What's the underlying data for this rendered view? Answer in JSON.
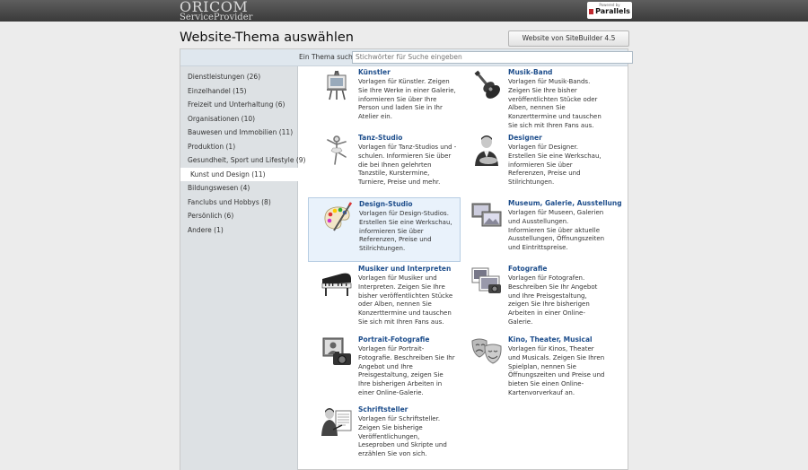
{
  "header": {
    "logo_line1": "ORICOM",
    "logo_line2": "ServiceProvider",
    "powered_by": "Powered by",
    "powered_brand": "Parallels"
  },
  "page": {
    "title": "Website-Thema auswählen",
    "import_button": "Website von SiteBuilder 4.5 importieren"
  },
  "search": {
    "label": "Ein Thema suchen",
    "placeholder": "Stichwörter für Suche eingeben"
  },
  "categories": [
    {
      "label": "Dienstleistungen (26)"
    },
    {
      "label": "Einzelhandel (15)"
    },
    {
      "label": "Freizeit und Unterhaltung (6)"
    },
    {
      "label": "Organisationen (10)"
    },
    {
      "label": "Bauwesen und Immobilien (11)"
    },
    {
      "label": "Produktion (1)"
    },
    {
      "label": "Gesundheit, Sport und Lifestyle (9)"
    },
    {
      "label": "Kunst und Design (11)",
      "active": true
    },
    {
      "label": "Bildungswesen (4)"
    },
    {
      "label": "Fanclubs und Hobbys (8)"
    },
    {
      "label": "Persönlich (6)"
    },
    {
      "label": "Andere (1)"
    }
  ],
  "themes": [
    {
      "title": "Künstler",
      "icon": "easel-icon",
      "desc": "Vorlagen für Künstler. Zeigen Sie Ihre Werke in einer Galerie, informieren Sie über Ihre Person und laden Sie in Ihr Atelier ein."
    },
    {
      "title": "Musik-Band",
      "icon": "guitar-icon",
      "desc": "Vorlagen für Musik-Bands. Zeigen Sie Ihre bisher veröffentlichten Stücke oder Alben, nennen Sie Konzerttermine und tauschen Sie sich mit Ihren Fans aus."
    },
    {
      "title": "Tanz-Studio",
      "icon": "dancer-icon",
      "desc": "Vorlagen für Tanz-Studios und -schulen. Informieren Sie über die bei Ihnen gelehrten Tanzstile, Kurstermine, Turniere, Preise und mehr."
    },
    {
      "title": "Designer",
      "icon": "designer-icon",
      "desc": "Vorlagen für Designer. Erstellen Sie eine Werkschau, informieren Sie über Referenzen, Preise und Stilrichtungen."
    },
    {
      "title": "Design-Studio",
      "icon": "palette-icon",
      "desc": "Vorlagen für Design-Studios. Erstellen Sie eine Werkschau, informieren Sie über Referenzen, Preise und Stilrichtungen.",
      "selected": true
    },
    {
      "title": "Museum, Galerie, Ausstellung",
      "icon": "gallery-icon",
      "desc": "Vorlagen für Museen, Galerien und Ausstellungen. Informieren Sie über aktuelle Ausstellungen, Öffnungszeiten und Eintrittspreise."
    },
    {
      "title": "Musiker und Interpreten",
      "icon": "piano-icon",
      "desc": "Vorlagen für Musiker und Interpreten. Zeigen Sie Ihre bisher veröffentlichten Stücke oder Alben, nennen Sie Konzerttermine und tauschen Sie sich mit Ihren Fans aus."
    },
    {
      "title": "Fotografie",
      "icon": "photos-icon",
      "desc": "Vorlagen für Fotografen. Beschreiben Sie Ihr Angebot und Ihre Preisgestaltung, zeigen Sie Ihre bisherigen Arbeiten in einer Online-Galerie."
    },
    {
      "title": "Portrait-Fotografie",
      "icon": "portrait-camera-icon",
      "desc": "Vorlagen für Portrait-Fotografie. Beschreiben Sie Ihr Angebot und Ihre Preisgestaltung, zeigen Sie Ihre bisherigen Arbeiten in einer Online-Galerie."
    },
    {
      "title": "Kino, Theater, Musical",
      "icon": "theater-masks-icon",
      "desc": "Vorlagen für Kinos, Theater und Musicals. Zeigen Sie Ihren Spielplan, nennen Sie Öffnungszeiten und Preise und bieten Sie einen Online-Kartenvorverkauf an."
    },
    {
      "title": "Schriftsteller",
      "icon": "writer-icon",
      "desc": "Vorlagen für Schriftsteller. Zeigen Sie bisherige Veröffentlichungen, Leseproben und Skripte und erzählen Sie von sich."
    }
  ]
}
